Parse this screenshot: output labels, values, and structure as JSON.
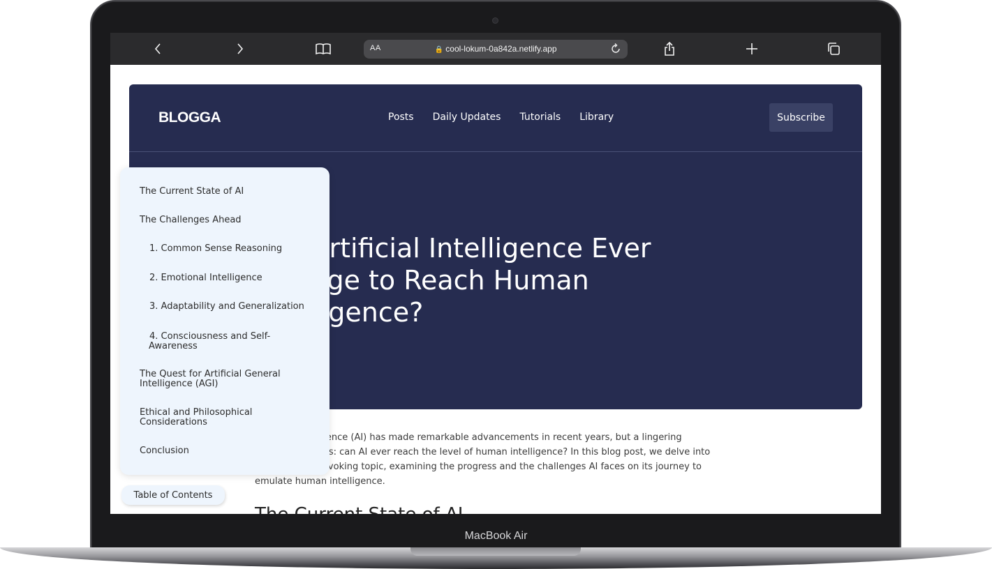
{
  "device_label": "MacBook Air",
  "browser": {
    "text_size_label": "AA",
    "url": "cool-lokum-0a842a.netlify.app",
    "icons": [
      "back-icon",
      "forward-icon",
      "bookmarks-icon",
      "lock-icon",
      "reload-icon",
      "share-icon",
      "new-tab-icon",
      "tabs-icon"
    ]
  },
  "nav": {
    "brand": "BLOGGA",
    "links": [
      "Posts",
      "Daily Updates",
      "Tutorials",
      "Library"
    ],
    "subscribe_label": "Subscribe"
  },
  "hero": {
    "title_line1": "Will Artificial Intelligence Ever",
    "title_line2": "Manage to Reach Human",
    "title_line3": "Intelligence?",
    "colors": {
      "background": "#262c50",
      "text": "#ffffff"
    }
  },
  "article": {
    "intro_line1": "Artificial Intelligence (AI) has made remarkable advancements in recent years, but a lingering",
    "intro_line2": "question remains: can AI ever reach the level of human intelligence? In this blog post, we delve into",
    "intro_line3": "this thought-provoking topic, examining the progress and the challenges AI faces on its journey to",
    "intro_line4": "emulate human intelligence.",
    "section_heading": "The Current State of AI"
  },
  "toc": {
    "items": [
      "The Current State of AI",
      "The Challenges Ahead",
      "1. Common Sense Reasoning",
      "2. Emotional Intelligence",
      "3. Adaptability and Generalization",
      "4. Consciousness and Self-",
      "Awareness",
      "The Quest for Artificial General",
      "Intelligence (AGI)",
      "Ethical and Philosophical",
      "Considerations",
      "Conclusion"
    ],
    "toggle_label": "Table of Contents",
    "colors": {
      "background": "#eef5fd"
    }
  }
}
